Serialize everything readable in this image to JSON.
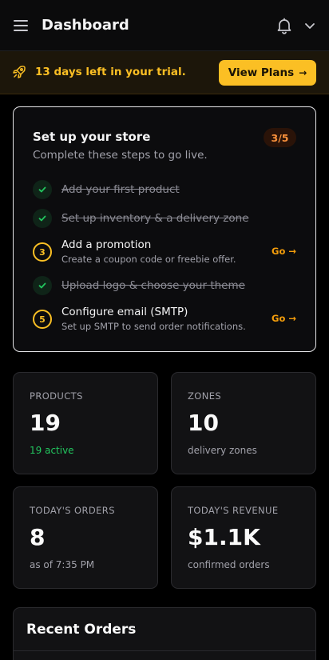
{
  "header": {
    "title": "Dashboard",
    "icons": [
      "menu-icon",
      "bell-icon",
      "chevron-down-icon"
    ]
  },
  "trial": {
    "text": "13 days left in your trial.",
    "button_label": "View Plans",
    "button_arrow": "→",
    "icon": "rocket-icon"
  },
  "setup": {
    "title": "Set up your store",
    "subtitle": "Complete these steps to go live.",
    "progress": "3/5",
    "go_label": "Go →",
    "steps": [
      {
        "title": "Add your first product",
        "done": true,
        "number": "1"
      },
      {
        "title": "Set up inventory & a delivery zone",
        "done": true,
        "number": "2"
      },
      {
        "title": "Add a promotion",
        "description": "Create a coupon code or freebie offer.",
        "done": false,
        "number": "3"
      },
      {
        "title": "Upload logo & choose your theme",
        "done": true,
        "number": "4"
      },
      {
        "title": "Configure email (SMTP)",
        "description": "Set up SMTP to send order notifications.",
        "done": false,
        "number": "5"
      }
    ]
  },
  "stats": [
    {
      "label": "PRODUCTS",
      "value": "19",
      "note": "19 active"
    },
    {
      "label": "ZONES",
      "value": "10",
      "note": "delivery zones"
    },
    {
      "label": "TODAY'S ORDERS",
      "value": "8",
      "note": "as of 7:35 PM"
    },
    {
      "label": "TODAY'S REVENUE",
      "value": "$1.1K",
      "note": "confirmed orders"
    }
  ],
  "recent_orders": {
    "title": "Recent Orders"
  },
  "colors": {
    "accent": "#fbbf24",
    "success": "#22c55e",
    "go_link": "#f59e0b",
    "background": "#000000"
  }
}
